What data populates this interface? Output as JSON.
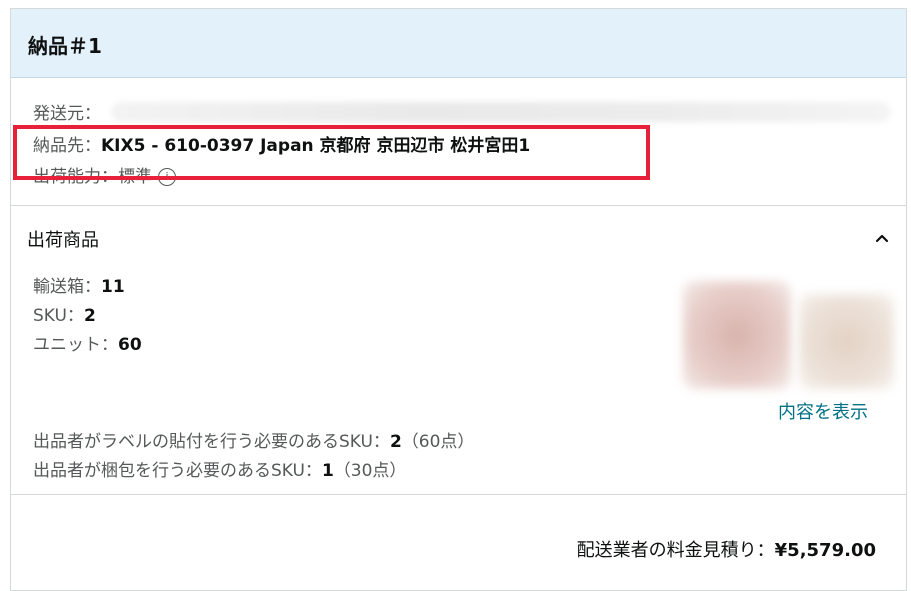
{
  "shipment": {
    "title": "納品＃1",
    "ship_from_label": "発送元：",
    "ship_to_label": "納品先：",
    "ship_to_value": "KIX5 - 610-0397 Japan 京都府 京田辺市 松井宮田1",
    "capacity_label": "出荷能力：",
    "capacity_value": "標準",
    "info_icon": "ⓘ"
  },
  "items_section": {
    "title": "出荷商品",
    "toggle_icon": "chevron-up-icon",
    "boxes_label": "輸送箱：",
    "boxes_value": "11",
    "sku_label": "SKU：",
    "sku_value": "2",
    "units_label": "ユニット：",
    "units_value": "60",
    "view_contents": "内容を表示",
    "label_note_label": "出品者がラベルの貼付を行う必要のあるSKU：",
    "label_note_value": "2",
    "label_note_suffix": "（60点）",
    "prep_note_label": "出品者が梱包を行う必要のあるSKU：",
    "prep_note_value": "1",
    "prep_note_suffix": "（30点）"
  },
  "estimate": {
    "label": "配送業者の料金見積り：",
    "value": "¥5,579.00"
  },
  "colors": {
    "header_bg": "#e3f1fb",
    "highlight": "#e8213b",
    "link": "#007185"
  }
}
